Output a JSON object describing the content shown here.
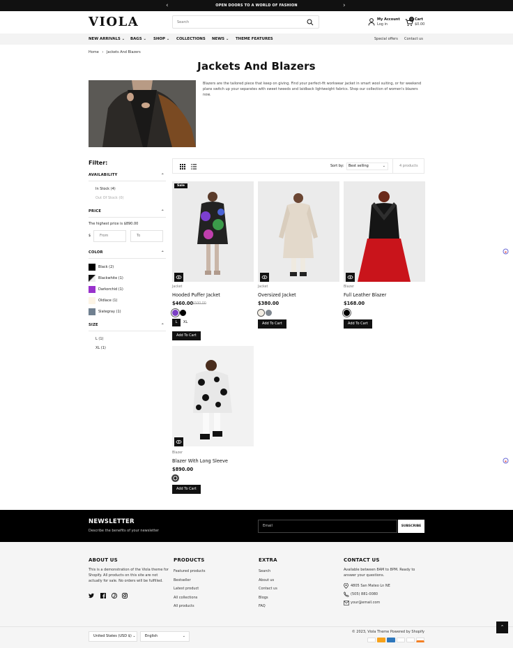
{
  "announcement": {
    "text": "OPEN DOORS TO A WORLD OF FASHION",
    "prev": "‹",
    "next": "›"
  },
  "header": {
    "logo": "VIOLA",
    "search_placeholder": "Search",
    "account_title": "My Account",
    "account_login": "Log in",
    "cart_title": "Cart",
    "cart_total": "$0.00",
    "cart_count": "0"
  },
  "nav": {
    "items": [
      "NEW ARRIVALS ⌄",
      "BAGS ⌄",
      "SHOP ⌄",
      "COLLECTIONS",
      "NEWS ⌄",
      "THEME FEATURES"
    ],
    "right": [
      "Special offers",
      "Contact us"
    ]
  },
  "breadcrumb": {
    "home": "Home",
    "sep": "›",
    "current": "Jackets And Blazers"
  },
  "collection": {
    "title": "Jackets And Blazers",
    "description": "Blazers are the tailored piece that keep on giving. Find your perfect-fit workwear jacket in smart wool suiting, or for weekend plans switch up your separates with sweet tweeds and laidback lightweight fabrics. Shop our collection of women's blazers now."
  },
  "filter": {
    "title": "Filter:",
    "availability": {
      "label": "AVAILABILITY",
      "options": [
        "In Stock (4)",
        "Out Of Stock (0)"
      ]
    },
    "price": {
      "label": "PRICE",
      "note": "The highest price is $890.00",
      "currency": "$",
      "from": "From",
      "to": "To"
    },
    "color": {
      "label": "COLOR",
      "options": [
        {
          "name": "Black (2)",
          "color": "#000000"
        },
        {
          "name": "Blackwhite (1)",
          "color": "#7a7a7a"
        },
        {
          "name": "Darkorchid (1)",
          "color": "#9932cc"
        },
        {
          "name": "Oldlace (1)",
          "color": "#fdf5e6"
        },
        {
          "name": "Slategray (1)",
          "color": "#708090"
        }
      ]
    },
    "size": {
      "label": "SIZE",
      "options": [
        "L (1)",
        "XL (1)"
      ]
    }
  },
  "toolbar": {
    "sort_label": "Sort by:",
    "sort_value": "Best selling",
    "count": "4 products"
  },
  "products": [
    {
      "vendor": "Jacket",
      "name": "Hooded Puffer Jacket",
      "price": "$460.00",
      "compare": "$500.00",
      "badge": "Sale",
      "sizes": [
        "L",
        "XL"
      ],
      "button": "Add To Cart",
      "colors": [
        "#7b3fc4",
        "#000000"
      ]
    },
    {
      "vendor": "Jacket",
      "name": "Oversized Jacket",
      "price": "$380.00",
      "button": "Add To Cart",
      "colors": [
        "#f3eee4",
        "#808890"
      ]
    },
    {
      "vendor": "Blazer",
      "name": "Full Leather Blazer",
      "price": "$168.00",
      "button": "Add To Cart",
      "colors": [
        "#000000"
      ]
    },
    {
      "vendor": "Blazer",
      "name": "Blazer With Long Sleeve",
      "price": "$890.00",
      "button": "Add To Cart",
      "colors": [
        "#555555"
      ]
    }
  ],
  "newsletter": {
    "title": "NEWSLETTER",
    "subtitle": "Describe the benefits of your newsletter",
    "placeholder": "Email",
    "button": "SUBSCRIBE"
  },
  "footer": {
    "about": {
      "title": "ABOUT US",
      "text": "This is a demonstration of the Viola theme for Shopify. All products on this site are not actually for sale. No orders will be fulfilled."
    },
    "products": {
      "title": "PRODUCTS",
      "links": [
        "Featured products",
        "Bestseller",
        "Latest product",
        "All collections",
        "All products"
      ]
    },
    "extra": {
      "title": "EXTRA",
      "links": [
        "Search",
        "About us",
        "Contact us",
        "Blogs",
        "FAQ"
      ]
    },
    "contact": {
      "title": "CONTACT US",
      "hours": "Available between 8AM to 8PM. Ready to answer your questions.",
      "address": "4805 San Mateo Ln NE",
      "phone": "(505) 881-0080",
      "email": "your@email.com"
    },
    "currency": "United States (USD $) ⌄",
    "language": "English",
    "copyright": "© 2023, Viola Theme Powered by Shopify"
  },
  "colors": {
    "accent": "#111111",
    "nav_bg": "#f3f3f3",
    "footer_bg": "#f5f5f5"
  }
}
